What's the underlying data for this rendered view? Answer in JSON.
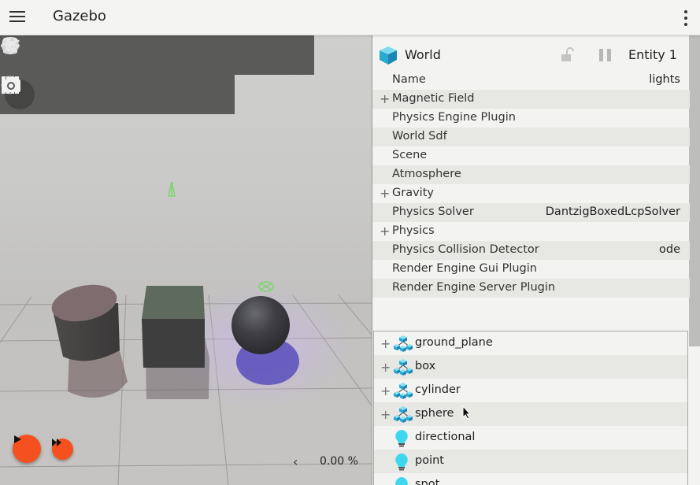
{
  "app": {
    "title": "Gazebo"
  },
  "scene": {
    "rtf_value": "0.00 %",
    "rtf_arrow": "‹"
  },
  "component_inspector": {
    "entity_name": "World",
    "entity_id_label": "Entity 1",
    "properties": [
      {
        "key": "Name",
        "value": "lights",
        "expandable": false
      },
      {
        "key": "Magnetic Field",
        "value": "",
        "expandable": true
      },
      {
        "key": "Physics Engine Plugin",
        "value": "",
        "expandable": false
      },
      {
        "key": "World Sdf",
        "value": "",
        "expandable": false
      },
      {
        "key": "Scene",
        "value": "",
        "expandable": false
      },
      {
        "key": "Atmosphere",
        "value": "",
        "expandable": false
      },
      {
        "key": "Gravity",
        "value": "",
        "expandable": true
      },
      {
        "key": "Physics Solver",
        "value": "DantzigBoxedLcpSolver",
        "expandable": false
      },
      {
        "key": "Physics",
        "value": "",
        "expandable": true
      },
      {
        "key": "Physics Collision Detector",
        "value": "ode",
        "expandable": false
      },
      {
        "key": "Render Engine Gui Plugin",
        "value": "",
        "expandable": false
      },
      {
        "key": "Render Engine Server Plugin",
        "value": "",
        "expandable": false
      }
    ]
  },
  "entity_tree": {
    "items": [
      {
        "label": "ground_plane",
        "kind": "model",
        "expandable": true
      },
      {
        "label": "box",
        "kind": "model",
        "expandable": true
      },
      {
        "label": "cylinder",
        "kind": "model",
        "expandable": true
      },
      {
        "label": "sphere",
        "kind": "model",
        "expandable": true
      },
      {
        "label": "directional",
        "kind": "light",
        "expandable": false
      },
      {
        "label": "point",
        "kind": "light",
        "expandable": false
      },
      {
        "label": "spot",
        "kind": "light",
        "expandable": false
      }
    ]
  },
  "colors": {
    "accent": "#f4511e",
    "toolbar": "#5a5a58",
    "model_icon": "#29b6d6",
    "light_icon": "#4dd0e1"
  }
}
